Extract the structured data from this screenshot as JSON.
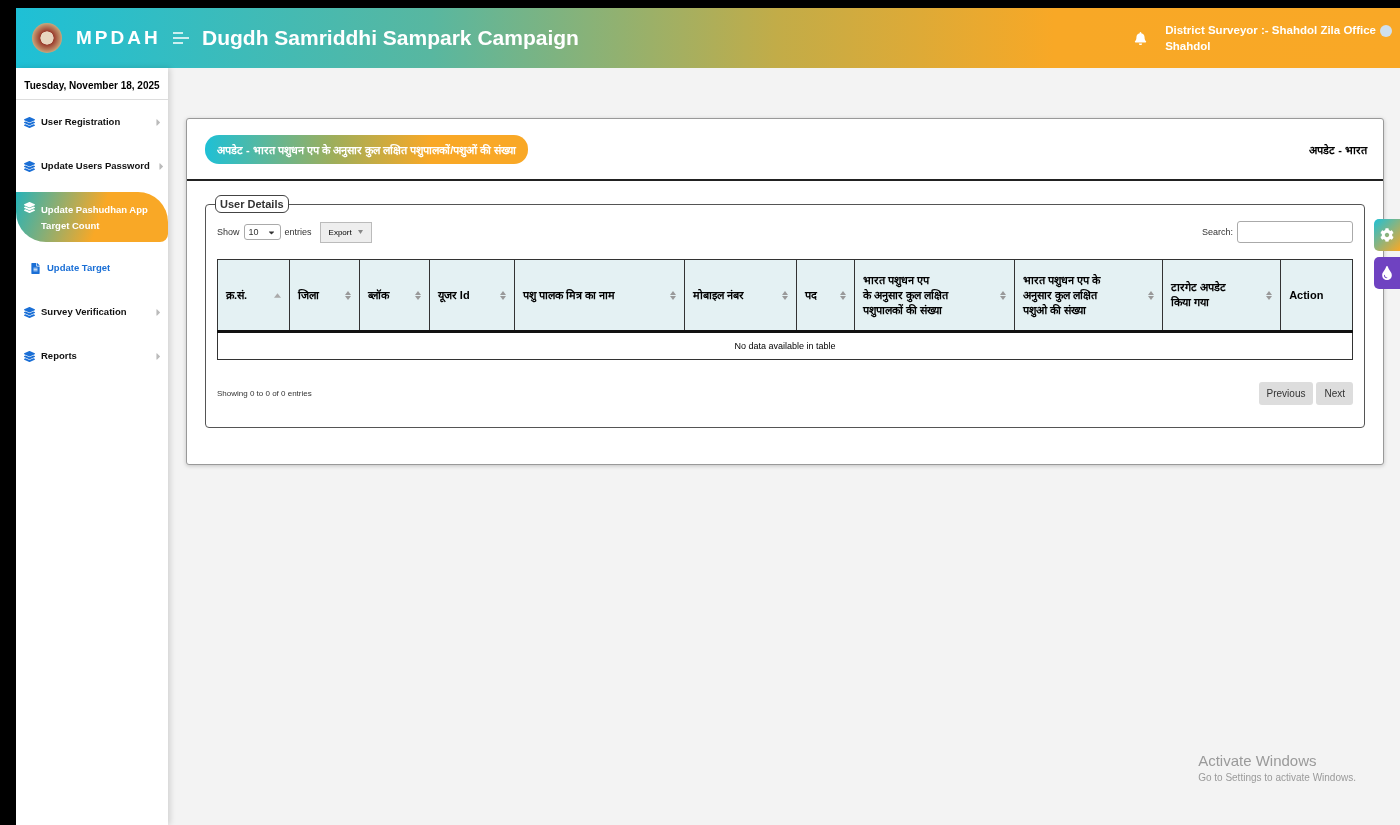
{
  "header": {
    "brand": "MPDAH",
    "title": "Dugdh Samriddhi Sampark Campaign",
    "user_line": "District Surveyor :- Shahdol Zila Office",
    "user_place": "Shahdol"
  },
  "sidebar": {
    "date": "Tuesday, November 18, 2025",
    "items": [
      {
        "label": "User Registration",
        "kind": "menu",
        "selected": false,
        "has_arrow": true
      },
      {
        "label": "Update Users Password",
        "kind": "menu",
        "selected": false,
        "has_arrow": true
      },
      {
        "label": "Update Pashudhan App Target Count",
        "kind": "menu",
        "selected": true,
        "has_arrow": false
      },
      {
        "label": "Update Target",
        "kind": "submenu",
        "selected": false,
        "has_arrow": false
      },
      {
        "label": "Survey Verification",
        "kind": "menu",
        "selected": false,
        "has_arrow": true
      },
      {
        "label": "Reports",
        "kind": "menu",
        "selected": false,
        "has_arrow": true
      }
    ]
  },
  "page": {
    "title_pill": "अपडेट - भारत पशुधन एप के अनुसार कुल लक्षित पशुपालकों/पशुओं की संख्या",
    "ticker": "अपडेट - भारत"
  },
  "panel": {
    "legend": "User Details",
    "show_label": "Show",
    "page_size": "10",
    "entries_label": "entries",
    "export_button": "Export",
    "search_label": "Search:",
    "table": {
      "columns": [
        {
          "label": "क्र.सं.",
          "sortable": true,
          "sorted": true
        },
        {
          "label": "जिला",
          "sortable": true,
          "sorted": false
        },
        {
          "label": "ब्लॉक",
          "sortable": true,
          "sorted": false
        },
        {
          "label": "यूजर Id",
          "sortable": true,
          "sorted": false
        },
        {
          "label": "पशु पालक मित्र का नाम",
          "sortable": true,
          "sorted": false
        },
        {
          "label": "मोबाइल नंबर",
          "sortable": true,
          "sorted": false
        },
        {
          "label": "पद",
          "sortable": true,
          "sorted": false
        },
        {
          "label": "भारत पशुधन एप\nके अनुसार कुल लक्षित\nपशुपालकों की संख्या",
          "sortable": true,
          "sorted": false
        },
        {
          "label": "भारत पशुधन एप के\nअनुसार कुल लक्षित\nपशुओ की संख्या",
          "sortable": true,
          "sorted": false
        },
        {
          "label": "टारगेट अपडेट\nकिया गया",
          "sortable": true,
          "sorted": false
        },
        {
          "label": "Action",
          "sortable": false
        }
      ],
      "empty_message": "No data available in table"
    },
    "info": "Showing 0 to 0 of 0 entries",
    "pagination": [
      "Previous",
      "Next"
    ]
  },
  "os_notice": {
    "title": "Activate Windows",
    "subtitle": "Go to Settings to activate Windows."
  }
}
